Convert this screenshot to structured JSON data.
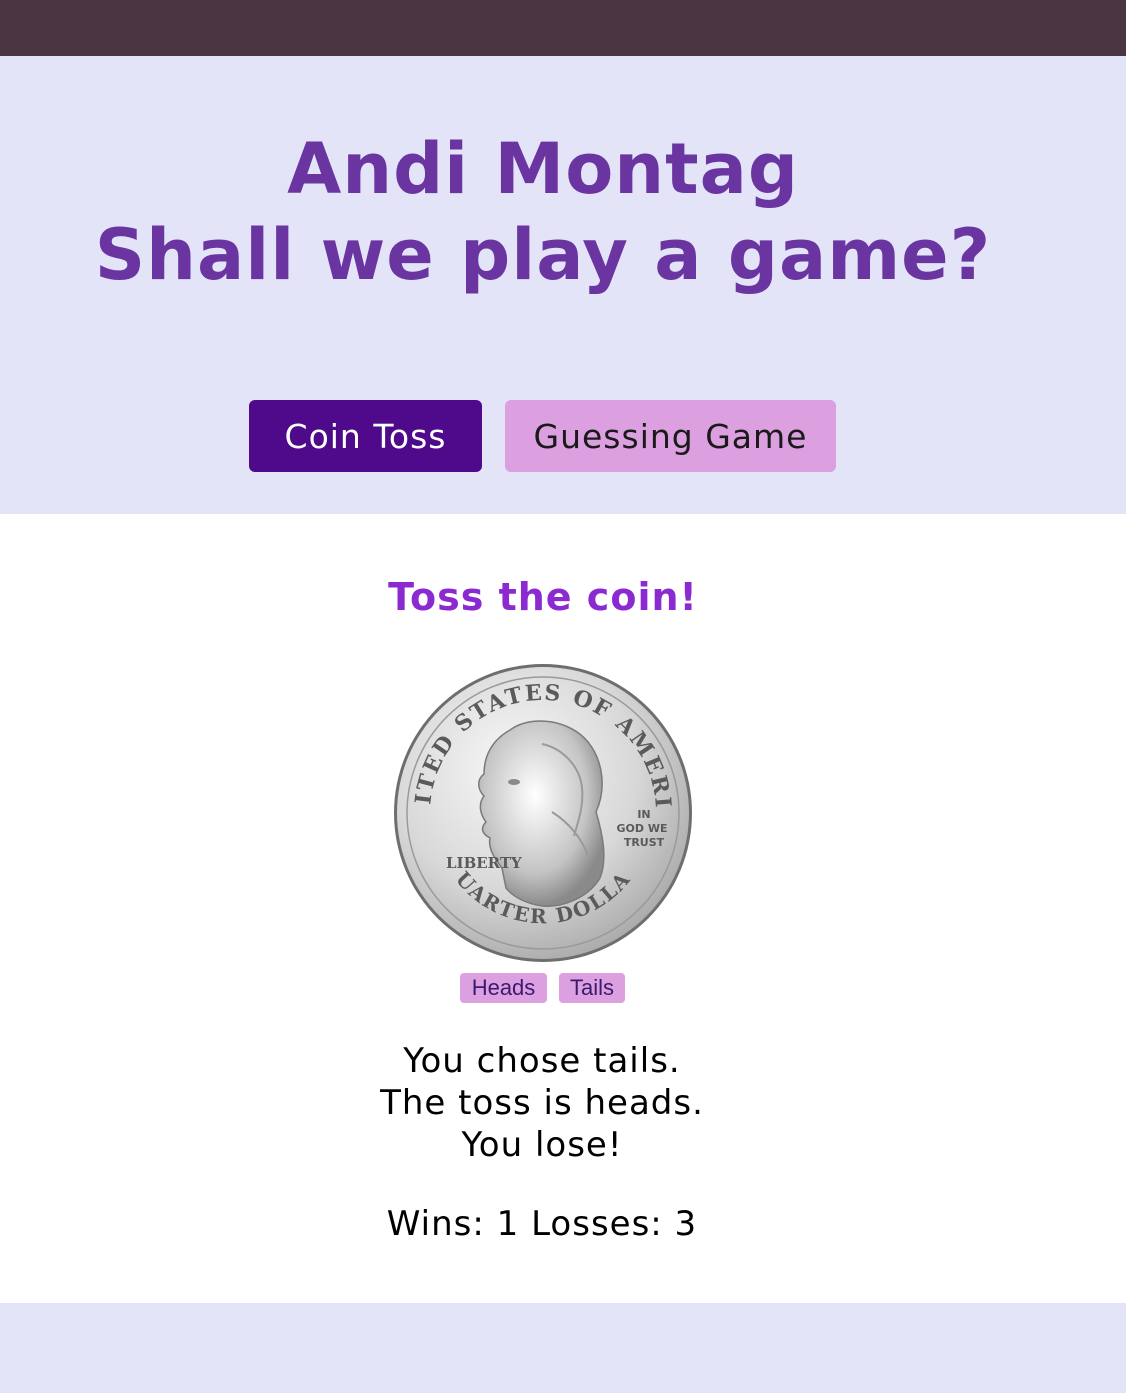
{
  "header": {
    "name": "Andi Montag",
    "tagline": "Shall we play a game?"
  },
  "nav": {
    "coin_toss": "Coin Toss",
    "guessing_game": "Guessing Game",
    "active": "coin_toss"
  },
  "game": {
    "heading": "Toss the coin!",
    "coin": {
      "top_text": "UNITED STATES OF AMERICA",
      "motto": [
        "IN",
        "GOD WE",
        "TRUST"
      ],
      "liberty": "LIBERTY",
      "bottom_text": "QUARTER DOLLAR"
    },
    "heads_label": "Heads",
    "tails_label": "Tails",
    "result_lines": [
      "You chose tails.",
      "The toss is heads.",
      "You lose!"
    ],
    "score_text": "Wins: 1 Losses: 3"
  },
  "colors": {
    "topbar": "#4a3440",
    "hero_bg": "#e4e4f8",
    "title": "#6a35a0",
    "active_button": "#4e0a8a",
    "inactive_button": "#dca0e0",
    "heading": "#8a2ad0"
  }
}
